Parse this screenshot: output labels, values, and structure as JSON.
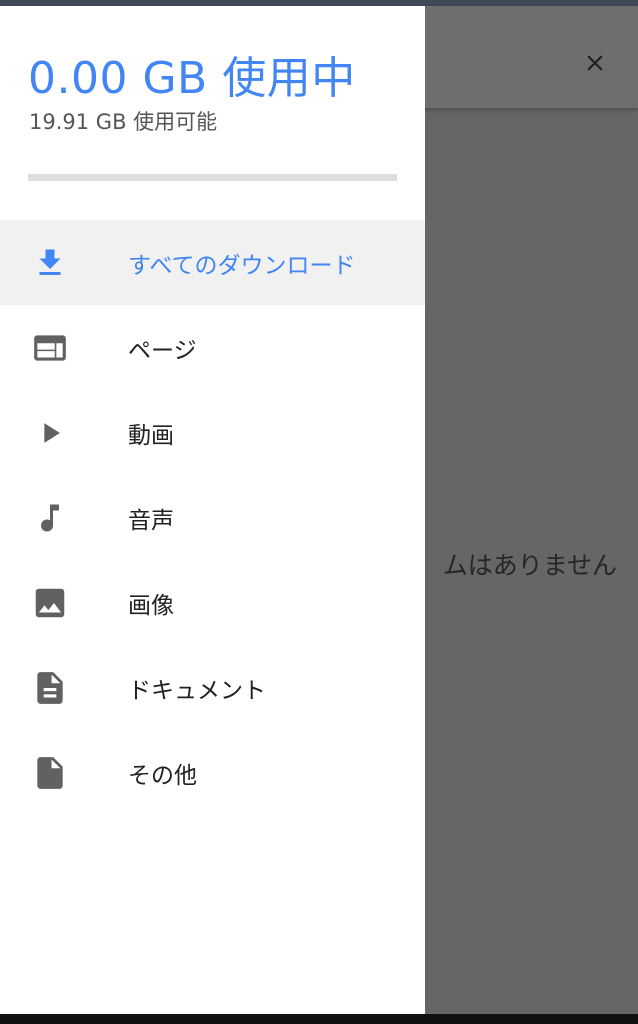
{
  "colors": {
    "accent": "#4285f4",
    "icon_default": "#616161",
    "scrim": "#666666",
    "drawer_bg": "#ffffff",
    "selected_bg": "#f1f1f1"
  },
  "storage": {
    "used_label": "0.00 GB 使用中",
    "available_label": "19.91 GB 使用可能",
    "used_fraction": 0.0
  },
  "menu": {
    "items": [
      {
        "label": "すべてのダウンロード",
        "icon": "download-icon",
        "selected": true
      },
      {
        "label": "ページ",
        "icon": "web-page-icon",
        "selected": false
      },
      {
        "label": "動画",
        "icon": "play-icon",
        "selected": false
      },
      {
        "label": "音声",
        "icon": "music-note-icon",
        "selected": false
      },
      {
        "label": "画像",
        "icon": "image-icon",
        "selected": false
      },
      {
        "label": "ドキュメント",
        "icon": "document-icon",
        "selected": false
      },
      {
        "label": "その他",
        "icon": "file-icon",
        "selected": false
      }
    ]
  },
  "background": {
    "close_icon": "close-icon",
    "empty_message": "ムはありません"
  }
}
